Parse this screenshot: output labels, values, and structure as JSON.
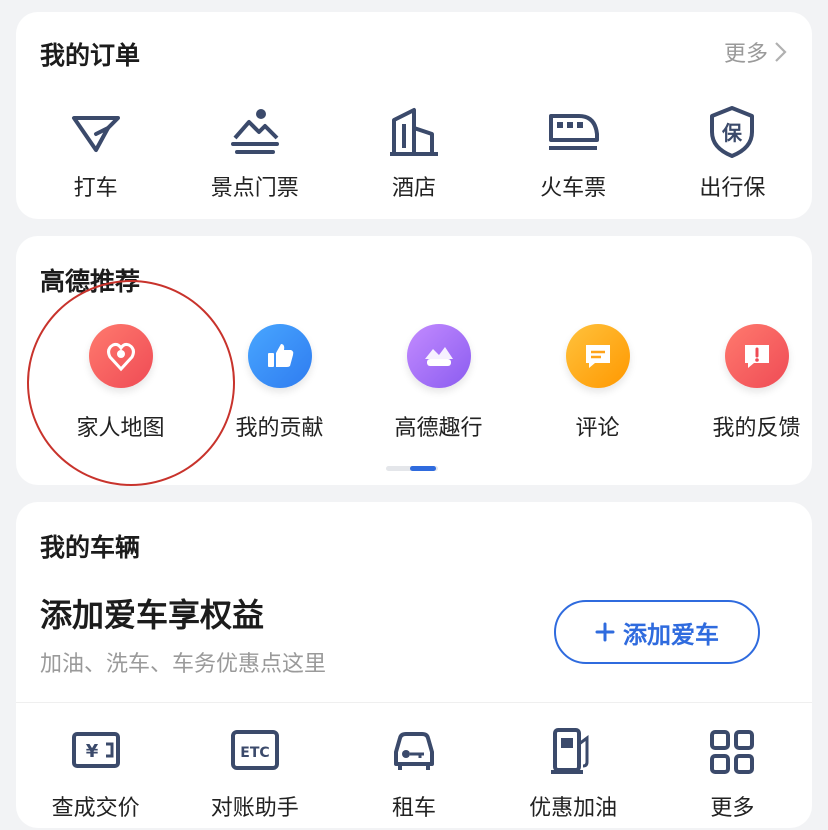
{
  "orders": {
    "title": "我的订单",
    "more": "更多",
    "items": [
      {
        "label": "打车",
        "icon": "taxi-icon"
      },
      {
        "label": "景点门票",
        "icon": "scenic-ticket-icon"
      },
      {
        "label": "酒店",
        "icon": "hotel-icon"
      },
      {
        "label": "火车票",
        "icon": "train-icon"
      },
      {
        "label": "出行保",
        "icon": "insurance-icon"
      }
    ]
  },
  "recommend": {
    "title": "高德推荐",
    "items": [
      {
        "label": "家人地图",
        "icon": "family-map-icon",
        "color": "#f2575a"
      },
      {
        "label": "我的贡献",
        "icon": "thumbs-up-icon",
        "color": "#2f86f6"
      },
      {
        "label": "高德趣行",
        "icon": "car-scene-icon",
        "color": "#a76cf5"
      },
      {
        "label": "评论",
        "icon": "comment-icon",
        "color": "#ffa31a"
      },
      {
        "label": "我的反馈",
        "icon": "feedback-icon",
        "color": "#f2575a"
      }
    ],
    "highlight_color": "#c8332c"
  },
  "vehicle": {
    "title": "我的车辆",
    "headline": "添加爱车享权益",
    "subtitle": "加油、洗车、车务优惠点这里",
    "add_button": "添加爱车",
    "items": [
      {
        "label": "查成交价",
        "icon": "price-icon"
      },
      {
        "label": "对账助手",
        "icon": "etc-icon"
      },
      {
        "label": "租车",
        "icon": "rental-car-icon"
      },
      {
        "label": "优惠加油",
        "icon": "fuel-icon"
      },
      {
        "label": "更多",
        "icon": "grid-more-icon"
      }
    ]
  },
  "colors": {
    "accent": "#2f6bde",
    "icon_stroke": "#3b4a6b"
  }
}
